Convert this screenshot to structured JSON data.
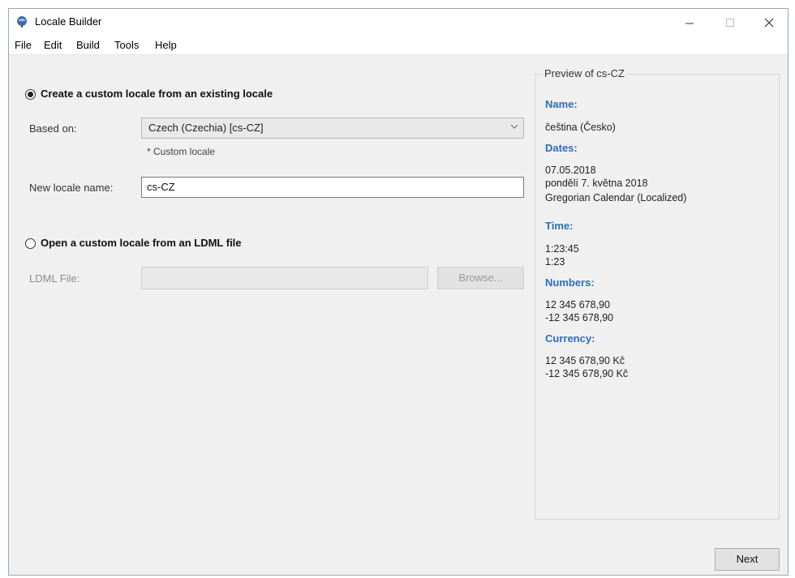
{
  "window": {
    "title": "Locale Builder"
  },
  "menu": [
    "File",
    "Edit",
    "Build",
    "Tools",
    "Help"
  ],
  "option_existing": {
    "label": "Create a custom locale from an existing locale",
    "based_on_label": "Based on:",
    "based_on_value": "Czech (Czechia) [cs-CZ]",
    "custom_note": "* Custom locale",
    "new_name_label": "New locale name:",
    "new_name_value": "cs-CZ",
    "selected": true
  },
  "option_ldml": {
    "label": "Open a custom locale from an LDML file",
    "file_label": "LDML File:",
    "file_value": "",
    "browse_label": "Browse...",
    "selected": false
  },
  "preview": {
    "title": "Preview of cs-CZ",
    "name_heading": "Name:",
    "name_value": "čeština (Česko)",
    "dates_heading": "Dates:",
    "dates": [
      "07.05.2018",
      "pondělí 7. května 2018",
      "Gregorian Calendar (Localized)"
    ],
    "time_heading": "Time:",
    "times": [
      "1:23:45",
      "1:23"
    ],
    "numbers_heading": "Numbers:",
    "numbers": [
      "12 345 678,90",
      "-12 345 678,90"
    ],
    "currency_heading": "Currency:",
    "currency": [
      "12 345 678,90 Kč",
      "-12 345 678,90 Kč"
    ]
  },
  "footer": {
    "next_label": "Next"
  },
  "colors": {
    "preview_heading": "#2e6fb8",
    "window_bg": "#f0f0f0"
  }
}
